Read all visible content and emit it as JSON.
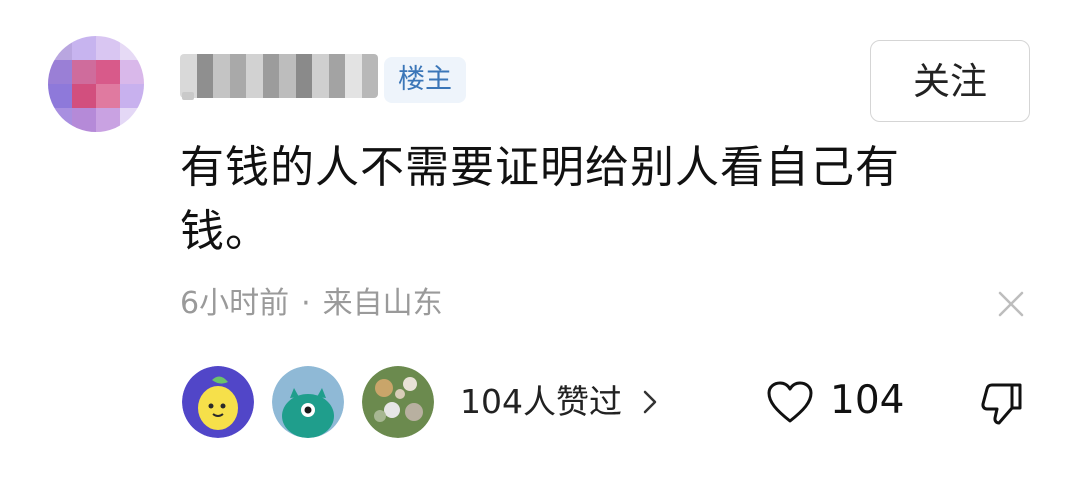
{
  "comment": {
    "author": {
      "avatar_icon": "pixelated-avatar",
      "op_badge": "楼主"
    },
    "follow_label": "关注",
    "text": "有钱的人不需要证明给别人看自己有钱。",
    "meta": {
      "time": "6小时前",
      "separator": "·",
      "location": "来自山东"
    },
    "close_icon": "close-icon",
    "likes": {
      "liker_avatars": [
        "lemon-face-avatar",
        "teal-monster-avatar",
        "photo-avatar"
      ],
      "summary": "104人赞过",
      "count": "104"
    },
    "icons": {
      "chevron": "chevron-right-icon",
      "heart": "heart-icon",
      "dislike": "thumb-down-icon"
    }
  },
  "colors": {
    "badge_text": "#3b76b8",
    "badge_bg": "#eef4fb",
    "meta_text": "#9a9a9a",
    "primary_text": "#111111"
  }
}
